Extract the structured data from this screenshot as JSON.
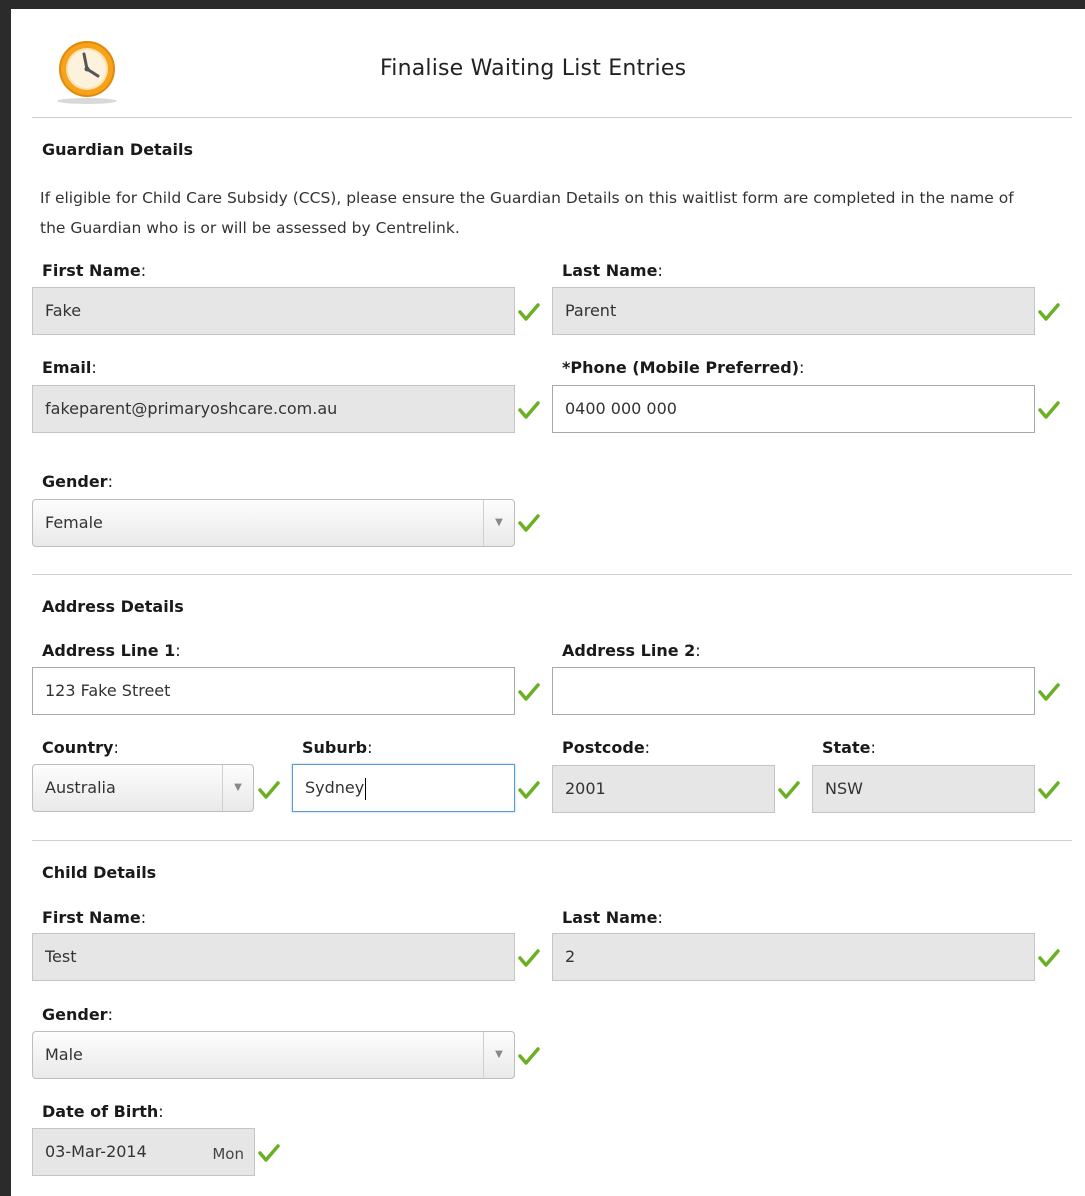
{
  "header": {
    "title": "Finalise Waiting List Entries",
    "logo_icon": "clock-icon",
    "accent_color": "#f5a31a"
  },
  "guardian": {
    "section_title": "Guardian Details",
    "note": "If eligible for Child Care Subsidy (CCS), please ensure the Guardian Details on this waitlist form are completed in the name of the Guardian who is or will be assessed by Centrelink.",
    "first_name": {
      "label": "First Name",
      "value": "Fake"
    },
    "last_name": {
      "label": "Last Name",
      "value": "Parent"
    },
    "email": {
      "label": "Email",
      "value": "fakeparent@primaryoshcare.com.au"
    },
    "phone": {
      "label": "*Phone (Mobile Preferred)",
      "value": "0400 000 000"
    },
    "gender": {
      "label": "Gender",
      "value": "Female"
    }
  },
  "address": {
    "section_title": "Address Details",
    "line1": {
      "label": "Address Line 1",
      "value": "123 Fake Street"
    },
    "line2": {
      "label": "Address Line 2",
      "value": ""
    },
    "country": {
      "label": "Country",
      "value": "Australia"
    },
    "suburb": {
      "label": "Suburb",
      "value": "Sydney"
    },
    "postcode": {
      "label": "Postcode",
      "value": "2001"
    },
    "state": {
      "label": "State",
      "value": "NSW"
    }
  },
  "child": {
    "section_title": "Child Details",
    "first_name": {
      "label": "First Name",
      "value": "Test"
    },
    "last_name": {
      "label": "Last Name",
      "value": "2"
    },
    "gender": {
      "label": "Gender",
      "value": "Male"
    },
    "dob": {
      "label": "Date of Birth",
      "value": "03-Mar-2014",
      "weekday": "Mon"
    }
  },
  "colon": ":",
  "icons": {
    "valid": "checkmark-icon",
    "dropdown": "dropdown-arrow-icon",
    "valid_color": "#6ab023"
  }
}
